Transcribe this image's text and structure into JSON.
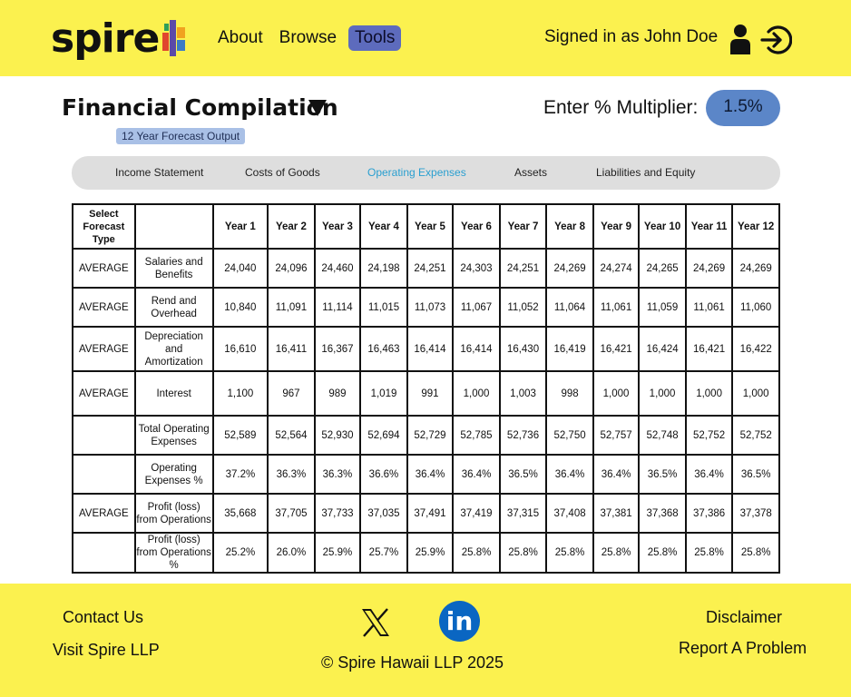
{
  "header": {
    "logo_text": "spire",
    "nav": [
      {
        "label": "About"
      },
      {
        "label": "Browse"
      },
      {
        "label": "Tools"
      }
    ],
    "signed_in_text": "Signed in as John Doe",
    "user_icon": "user-icon",
    "logout_icon": "logout-icon"
  },
  "page": {
    "title": "Financial Compilation",
    "subtitle_badge": "12 Year Forecast Output",
    "multiplier_label": "Enter % Multiplier:",
    "multiplier_value": "1.5%"
  },
  "tabs": [
    {
      "label": "Income Statement"
    },
    {
      "label": "Costs of Goods"
    },
    {
      "label": "Operating Expenses",
      "active": true
    },
    {
      "label": "Assets"
    },
    {
      "label": "Liabilities and Equity"
    }
  ],
  "table": {
    "headers": [
      "Select Forecast Type",
      "",
      "Year 1",
      "Year 2",
      "Year 3",
      "Year 4",
      "Year 5",
      "Year 6",
      "Year 7",
      "Year 8",
      "Year 9",
      "Year 10",
      "Year 11",
      "Year 12"
    ],
    "rows": [
      {
        "type": "AVERAGE",
        "label": "Salaries and Benefits",
        "values": [
          "24,040",
          "24,096",
          "24,460",
          "24,198",
          "24,251",
          "24,303",
          "24,251",
          "24,269",
          "24,274",
          "24,265",
          "24,269",
          "24,269"
        ]
      },
      {
        "type": "AVERAGE",
        "label": "Rend and Overhead",
        "values": [
          "10,840",
          "11,091",
          "11,114",
          "11,015",
          "11,073",
          "11,067",
          "11,052",
          "11,064",
          "11,061",
          "11,059",
          "11,061",
          "11,060"
        ]
      },
      {
        "type": "AVERAGE",
        "label": "Depreciation and Amortization",
        "values": [
          "16,610",
          "16,411",
          "16,367",
          "16,463",
          "16,414",
          "16,414",
          "16,430",
          "16,419",
          "16,421",
          "16,424",
          "16,421",
          "16,422"
        ]
      },
      {
        "type": "AVERAGE",
        "label": "Interest",
        "values": [
          "1,100",
          "967",
          "989",
          "1,019",
          "991",
          "1,000",
          "1,003",
          "998",
          "1,000",
          "1,000",
          "1,000",
          "1,000"
        ]
      },
      {
        "type": "",
        "label": "Total Operating Expenses",
        "values": [
          "52,589",
          "52,564",
          "52,930",
          "52,694",
          "52,729",
          "52,785",
          "52,736",
          "52,750",
          "52,757",
          "52,748",
          "52,752",
          "52,752"
        ]
      },
      {
        "type": "",
        "label": "Operating Expenses %",
        "values": [
          "37.2%",
          "36.3%",
          "36.3%",
          "36.6%",
          "36.4%",
          "36.4%",
          "36.5%",
          "36.4%",
          "36.4%",
          "36.5%",
          "36.4%",
          "36.5%"
        ]
      },
      {
        "type": "AVERAGE",
        "label": "Profit (loss) from Operations",
        "values": [
          "35,668",
          "37,705",
          "37,733",
          "37,035",
          "37,491",
          "37,419",
          "37,315",
          "37,408",
          "37,381",
          "37,368",
          "37,386",
          "37,378"
        ]
      },
      {
        "type": "",
        "label": "Profit (loss) from Operations %",
        "values": [
          "25.2%",
          "26.0%",
          "25.9%",
          "25.7%",
          "25.9%",
          "25.8%",
          "25.8%",
          "25.8%",
          "25.8%",
          "25.8%",
          "25.8%",
          "25.8%"
        ]
      }
    ]
  },
  "footer": {
    "contact": "Contact Us",
    "visit": "Visit Spire LLP",
    "copyright": "© Spire Hawaii LLP 2025",
    "disclaimer": "Disclaimer",
    "report": "Report A Problem",
    "social_x_icon": "x-icon",
    "social_linkedin_icon": "linkedin-icon",
    "linkedin_glyph": "in"
  },
  "colors": {
    "brand_yellow": "#fbf14f",
    "nav_active": "#5d6bbd",
    "multiplier_pill": "#5b86c8",
    "tab_active": "#2a9fd0",
    "badge": "#a9c0e6",
    "linkedin_blue": "#0a66c2"
  }
}
